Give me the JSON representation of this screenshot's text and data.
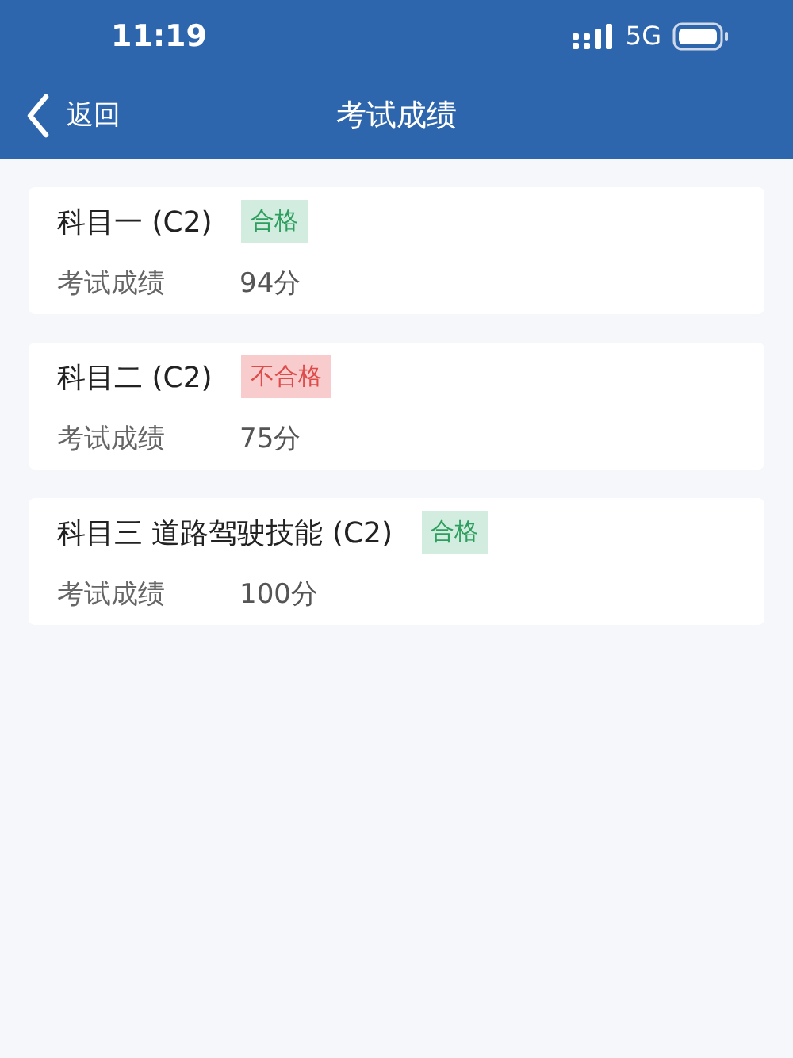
{
  "status_bar": {
    "time": "11:19",
    "network": "5G"
  },
  "nav": {
    "back": "返回",
    "title": "考试成绩"
  },
  "results": [
    {
      "subject": "科目一 (C2)",
      "result": "合格",
      "passed": true,
      "label": "考试成绩",
      "score": "94分"
    },
    {
      "subject": "科目二 (C2)",
      "result": "不合格",
      "passed": false,
      "label": "考试成绩",
      "score": "75分"
    },
    {
      "subject": "科目三 道路驾驶技能 (C2)",
      "result": "合格",
      "passed": true,
      "label": "考试成绩",
      "score": "100分"
    }
  ]
}
